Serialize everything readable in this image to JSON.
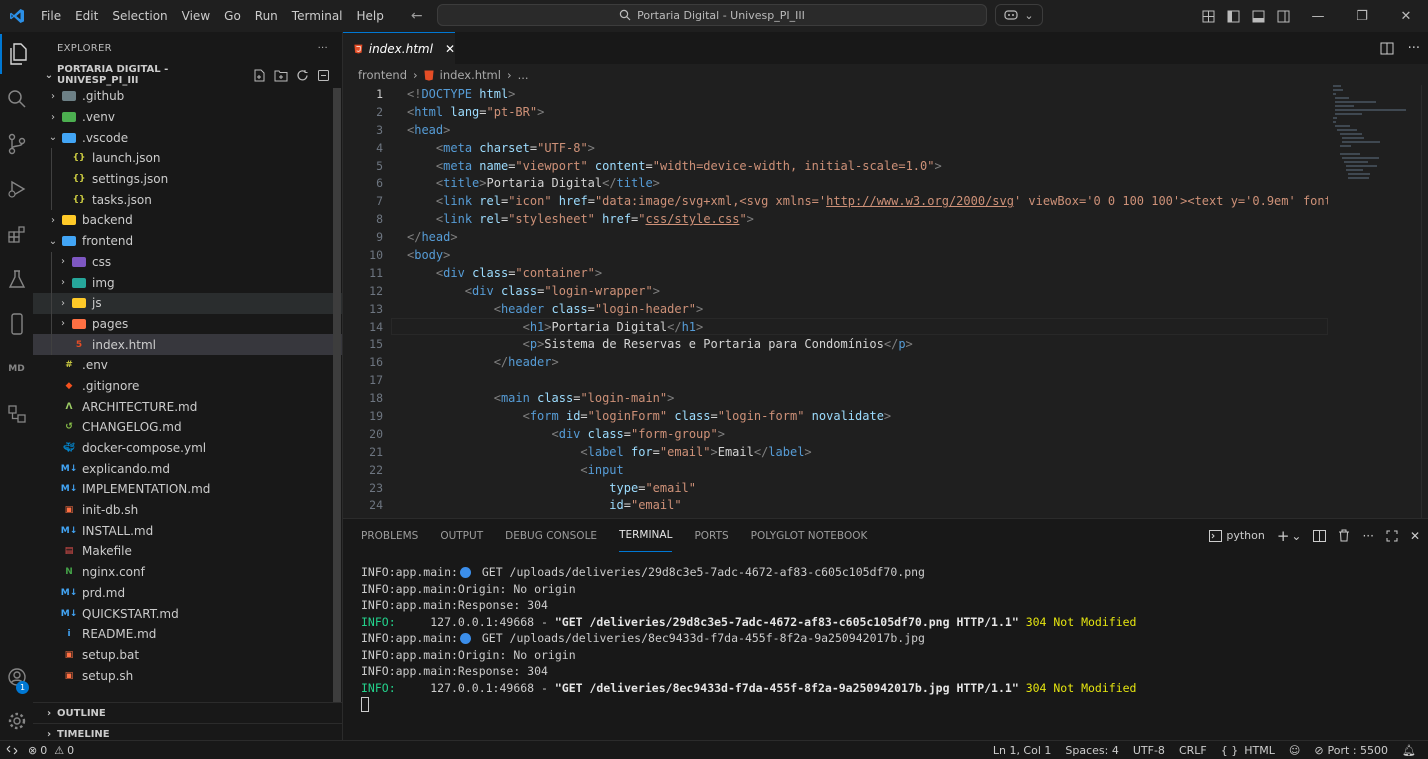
{
  "titlebar": {
    "menu": [
      "File",
      "Edit",
      "Selection",
      "View",
      "Go",
      "Run",
      "Terminal",
      "Help"
    ],
    "search_text": "Portaria Digital - Univesp_PI_III"
  },
  "sidebar": {
    "header": "EXPLORER",
    "project": "PORTARIA DIGITAL - UNIVESP_PI_III",
    "items": [
      {
        "label": ".github",
        "kind": "folder",
        "color": "#6d8086",
        "depth": 0,
        "expanded": false
      },
      {
        "label": ".venv",
        "kind": "folder",
        "color": "#4caf50",
        "depth": 0,
        "expanded": false
      },
      {
        "label": ".vscode",
        "kind": "folder",
        "color": "#42a5f5",
        "depth": 0,
        "expanded": true
      },
      {
        "label": "launch.json",
        "kind": "json",
        "color": "#cbcb41",
        "depth": 1
      },
      {
        "label": "settings.json",
        "kind": "json",
        "color": "#cbcb41",
        "depth": 1
      },
      {
        "label": "tasks.json",
        "kind": "json",
        "color": "#cbcb41",
        "depth": 1
      },
      {
        "label": "backend",
        "kind": "folder",
        "color": "#ffca28",
        "depth": 0,
        "expanded": false
      },
      {
        "label": "frontend",
        "kind": "folder",
        "color": "#42a5f5",
        "depth": 0,
        "expanded": true
      },
      {
        "label": "css",
        "kind": "folder",
        "color": "#7e57c2",
        "depth": 1,
        "expanded": false
      },
      {
        "label": "img",
        "kind": "folder",
        "color": "#26a69a",
        "depth": 1,
        "expanded": false
      },
      {
        "label": "js",
        "kind": "folder",
        "color": "#ffca28",
        "depth": 1,
        "expanded": false,
        "state": "hover"
      },
      {
        "label": "pages",
        "kind": "folder",
        "color": "#ff7043",
        "depth": 1,
        "expanded": false
      },
      {
        "label": "index.html",
        "kind": "html",
        "color": "#e44d26",
        "depth": 1,
        "state": "selected"
      },
      {
        "label": ".env",
        "kind": "env",
        "color": "#cbcb41",
        "depth": 0
      },
      {
        "label": ".gitignore",
        "kind": "git",
        "color": "#f4511e",
        "depth": 0
      },
      {
        "label": "ARCHITECTURE.md",
        "kind": "arch",
        "color": "#9ccc65",
        "depth": 0
      },
      {
        "label": "CHANGELOG.md",
        "kind": "changelog",
        "color": "#8bc34a",
        "depth": 0
      },
      {
        "label": "docker-compose.yml",
        "kind": "docker",
        "color": "#0288d1",
        "depth": 0
      },
      {
        "label": "explicando.md",
        "kind": "md",
        "color": "#42a5f5",
        "depth": 0
      },
      {
        "label": "IMPLEMENTATION.md",
        "kind": "md",
        "color": "#42a5f5",
        "depth": 0
      },
      {
        "label": "init-db.sh",
        "kind": "sh",
        "color": "#ff7043",
        "depth": 0
      },
      {
        "label": "INSTALL.md",
        "kind": "md",
        "color": "#42a5f5",
        "depth": 0
      },
      {
        "label": "Makefile",
        "kind": "make",
        "color": "#ef5350",
        "depth": 0
      },
      {
        "label": "nginx.conf",
        "kind": "nginx",
        "color": "#43a047",
        "depth": 0
      },
      {
        "label": "prd.md",
        "kind": "md",
        "color": "#42a5f5",
        "depth": 0
      },
      {
        "label": "QUICKSTART.md",
        "kind": "md",
        "color": "#42a5f5",
        "depth": 0
      },
      {
        "label": "README.md",
        "kind": "readme",
        "color": "#42a5f5",
        "depth": 0
      },
      {
        "label": "setup.bat",
        "kind": "sh",
        "color": "#ff7043",
        "depth": 0
      },
      {
        "label": "setup.sh",
        "kind": "sh",
        "color": "#ff7043",
        "depth": 0
      }
    ],
    "sections": [
      "OUTLINE",
      "TIMELINE"
    ]
  },
  "activity": {
    "md_label": "MD",
    "badge": "1"
  },
  "editor": {
    "tab": "index.html",
    "breadcrumb": [
      "frontend",
      "index.html",
      "..."
    ],
    "current_line": 14,
    "lines": [
      {
        "n": 1,
        "indent": "",
        "html": "<span class='tg'>&lt;!</span><span class='tn'>DOCTYPE</span> <span class='at'>html</span><span class='tg'>&gt;</span>"
      },
      {
        "n": 2,
        "indent": "",
        "html": "<span class='tg'>&lt;</span><span class='tn'>html</span> <span class='at'>lang</span><span class='tx'>=</span><span class='st'>\"pt-BR\"</span><span class='tg'>&gt;</span>"
      },
      {
        "n": 3,
        "indent": "",
        "html": "<span class='tg'>&lt;</span><span class='tn'>head</span><span class='tg'>&gt;</span>"
      },
      {
        "n": 4,
        "indent": "    ",
        "html": "<span class='tg'>&lt;</span><span class='tn'>meta</span> <span class='at'>charset</span><span class='tx'>=</span><span class='st'>\"UTF-8\"</span><span class='tg'>&gt;</span>"
      },
      {
        "n": 5,
        "indent": "    ",
        "html": "<span class='tg'>&lt;</span><span class='tn'>meta</span> <span class='at'>name</span><span class='tx'>=</span><span class='st'>\"viewport\"</span> <span class='at'>content</span><span class='tx'>=</span><span class='st'>\"width=device-width, initial-scale=1.0\"</span><span class='tg'>&gt;</span>"
      },
      {
        "n": 6,
        "indent": "    ",
        "html": "<span class='tg'>&lt;</span><span class='tn'>title</span><span class='tg'>&gt;</span><span class='tx'>Portaria Digital</span><span class='tg'>&lt;/</span><span class='tn'>title</span><span class='tg'>&gt;</span>"
      },
      {
        "n": 7,
        "indent": "    ",
        "html": "<span class='tg'>&lt;</span><span class='tn'>link</span> <span class='at'>rel</span><span class='tx'>=</span><span class='st'>\"icon\"</span> <span class='at'>href</span><span class='tx'>=</span><span class='st'>\"data:image/svg+xml,&lt;svg xmlns='<u>http://www.w3.org/2000/svg</u>' viewBox='0 0 100 100'&gt;&lt;text y='0.9em' font</span>"
      },
      {
        "n": 8,
        "indent": "    ",
        "html": "<span class='tg'>&lt;</span><span class='tn'>link</span> <span class='at'>rel</span><span class='tx'>=</span><span class='st'>\"stylesheet\"</span> <span class='at'>href</span><span class='tx'>=</span><span class='st'>\"<u>css/style.css</u>\"</span><span class='tg'>&gt;</span>"
      },
      {
        "n": 9,
        "indent": "",
        "html": "<span class='tg'>&lt;/</span><span class='tn'>head</span><span class='tg'>&gt;</span>"
      },
      {
        "n": 10,
        "indent": "",
        "html": "<span class='tg'>&lt;</span><span class='tn'>body</span><span class='tg'>&gt;</span>"
      },
      {
        "n": 11,
        "indent": "    ",
        "html": "<span class='tg'>&lt;</span><span class='tn'>div</span> <span class='at'>class</span><span class='tx'>=</span><span class='st'>\"container\"</span><span class='tg'>&gt;</span>"
      },
      {
        "n": 12,
        "indent": "        ",
        "html": "<span class='tg'>&lt;</span><span class='tn'>div</span> <span class='at'>class</span><span class='tx'>=</span><span class='st'>\"login-wrapper\"</span><span class='tg'>&gt;</span>"
      },
      {
        "n": 13,
        "indent": "            ",
        "html": "<span class='tg'>&lt;</span><span class='tn'>header</span> <span class='at'>class</span><span class='tx'>=</span><span class='st'>\"login-header\"</span><span class='tg'>&gt;</span>"
      },
      {
        "n": 14,
        "indent": "                ",
        "html": "<span class='tg'>&lt;</span><span class='tn'>h1</span><span class='tg'>&gt;</span><span class='tx'>Portaria Digital</span><span class='tg'>&lt;/</span><span class='tn'>h1</span><span class='tg'>&gt;</span>"
      },
      {
        "n": 15,
        "indent": "                ",
        "html": "<span class='tg'>&lt;</span><span class='tn'>p</span><span class='tg'>&gt;</span><span class='tx'>Sistema de Reservas e Portaria para Condomínios</span><span class='tg'>&lt;/</span><span class='tn'>p</span><span class='tg'>&gt;</span>"
      },
      {
        "n": 16,
        "indent": "            ",
        "html": "<span class='tg'>&lt;/</span><span class='tn'>header</span><span class='tg'>&gt;</span>"
      },
      {
        "n": 17,
        "indent": "",
        "html": ""
      },
      {
        "n": 18,
        "indent": "            ",
        "html": "<span class='tg'>&lt;</span><span class='tn'>main</span> <span class='at'>class</span><span class='tx'>=</span><span class='st'>\"login-main\"</span><span class='tg'>&gt;</span>"
      },
      {
        "n": 19,
        "indent": "                ",
        "html": "<span class='tg'>&lt;</span><span class='tn'>form</span> <span class='at'>id</span><span class='tx'>=</span><span class='st'>\"loginForm\"</span> <span class='at'>class</span><span class='tx'>=</span><span class='st'>\"login-form\"</span> <span class='at'>novalidate</span><span class='tg'>&gt;</span>"
      },
      {
        "n": 20,
        "indent": "                    ",
        "html": "<span class='tg'>&lt;</span><span class='tn'>div</span> <span class='at'>class</span><span class='tx'>=</span><span class='st'>\"form-group\"</span><span class='tg'>&gt;</span>"
      },
      {
        "n": 21,
        "indent": "                        ",
        "html": "<span class='tg'>&lt;</span><span class='tn'>label</span> <span class='at'>for</span><span class='tx'>=</span><span class='st'>\"email\"</span><span class='tg'>&gt;</span><span class='tx'>Email</span><span class='tg'>&lt;/</span><span class='tn'>label</span><span class='tg'>&gt;</span>"
      },
      {
        "n": 22,
        "indent": "                        ",
        "html": "<span class='tg'>&lt;</span><span class='tn'>input</span>"
      },
      {
        "n": 23,
        "indent": "                            ",
        "html": "<span class='at'>type</span><span class='tx'>=</span><span class='st'>\"email\"</span>"
      },
      {
        "n": 24,
        "indent": "                            ",
        "html": "<span class='at'>id</span><span class='tx'>=</span><span class='st'>\"email\"</span>"
      }
    ]
  },
  "panel": {
    "tabs": [
      "PROBLEMS",
      "OUTPUT",
      "DEBUG CONSOLE",
      "TERMINAL",
      "PORTS",
      "POLYGLOT NOTEBOOK"
    ],
    "active_tab": "TERMINAL",
    "shell": "python",
    "terminal_lines": [
      {
        "type": "dot",
        "prefix": "INFO:app.main:",
        "text": " GET /uploads/deliveries/29d8c3e5-7adc-4672-af83-c605c105df70.png"
      },
      {
        "type": "plain",
        "text": "INFO:app.main:Origin: No origin"
      },
      {
        "type": "plain",
        "text": "INFO:app.main:Response: 304"
      },
      {
        "type": "access",
        "prefix": "INFO:",
        "addr": "     127.0.0.1:49668 - ",
        "req": "\"GET /deliveries/29d8c3e5-7adc-4672-af83-c605c105df70.png HTTP/1.1\"",
        "status": " 304 Not Modified"
      },
      {
        "type": "dot",
        "prefix": "INFO:app.main:",
        "text": " GET /uploads/deliveries/8ec9433d-f7da-455f-8f2a-9a250942017b.jpg"
      },
      {
        "type": "plain",
        "text": "INFO:app.main:Origin: No origin"
      },
      {
        "type": "plain",
        "text": "INFO:app.main:Response: 304"
      },
      {
        "type": "access",
        "prefix": "INFO:",
        "addr": "     127.0.0.1:49668 - ",
        "req": "\"GET /deliveries/8ec9433d-f7da-455f-8f2a-9a250942017b.jpg HTTP/1.1\"",
        "status": " 304 Not Modified"
      }
    ]
  },
  "statusbar": {
    "errors": "0",
    "warnings": "0",
    "position": "Ln 1, Col 1",
    "spaces": "Spaces: 4",
    "encoding": "UTF-8",
    "eol": "CRLF",
    "language": "HTML",
    "port": "Port : 5500"
  }
}
